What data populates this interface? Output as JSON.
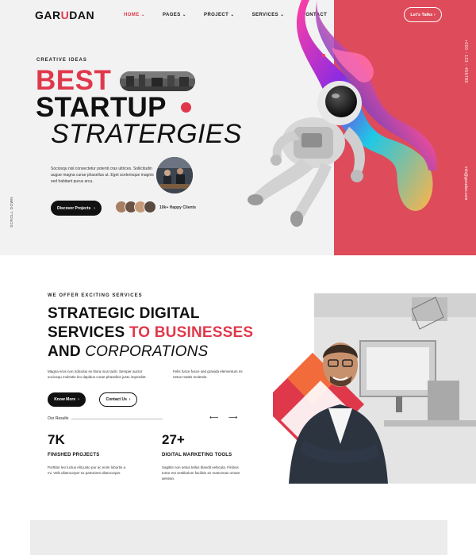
{
  "brand": {
    "logo_pre": "GAR",
    "logo_hl": "U",
    "logo_post": "DAN"
  },
  "nav": {
    "items": [
      {
        "label": "HOME",
        "chevron": "⌄",
        "active": true
      },
      {
        "label": "PAGES",
        "chevron": "⌄",
        "active": false
      },
      {
        "label": "PROJECT",
        "chevron": "⌄",
        "active": false
      },
      {
        "label": "SERVICES",
        "chevron": "⌄",
        "active": false
      },
      {
        "label": "CONTACT",
        "chevron": "",
        "active": false
      }
    ],
    "cta": "Let's Talks ›"
  },
  "hero": {
    "eyebrow": "CREATIVE IDEAS",
    "line1": "BEST",
    "line2": "STARTUP",
    "line3": "STRATERGIES",
    "description": "Sociosqu nisl consectetur potenti cras ultrices. Sollicitudin augue magna curae phasellus ut. Eget scelerisque magnis sed habitant purus arcu.",
    "discover_btn": "Discover Projects",
    "discover_arrow": "›",
    "clients": "10k+ Happy Clients",
    "side_phone": "+000 - 123 - 456789",
    "side_mail": "info@garudan.com",
    "side_scroll": "SCROLL DOWN"
  },
  "services": {
    "eyebrow": "WE OFFER EXCITING SERVICES",
    "h1": "STRATEGIC DIGITAL",
    "h2_a": "SERVICES ",
    "h2_b": "TO BUSINESSES",
    "h3_a": "AND ",
    "h3_b": "CORPORATIONS",
    "para1": "Magna eros non ridiculus ex litora mus taciti. Semper auctor sociosqu molestie leo dapibus curae phasellus justo imperdiet.",
    "para2": "Felis fusce fusce sed gravida elementum mi netus mattis molestie.",
    "know_btn": "Know More",
    "contact_btn": "Contact Us",
    "btn_arrow": "›",
    "results_label": "Our Results",
    "arrow_prev": "⟵",
    "arrow_next": "⟶",
    "stats": [
      {
        "num": "7K",
        "label": "FINISHED PROJECTS",
        "desc": "Porttitor leo luctus elit justo pur ac enim lobortis a mi. Velit ullamcorper ex parturient ullamcorper."
      },
      {
        "num": "27+",
        "label": "DIGITAL MARKETING TOOLS",
        "desc": "Sagittis non netus tellus blandit vehicula. Finibus tortor est vestibulum facilisis ex maecenas ornare aenean."
      }
    ]
  },
  "colors": {
    "accent": "#e0384b",
    "hero_red": "#de4b5a",
    "hero_bg": "#f2f2f2",
    "dark": "#111111"
  }
}
